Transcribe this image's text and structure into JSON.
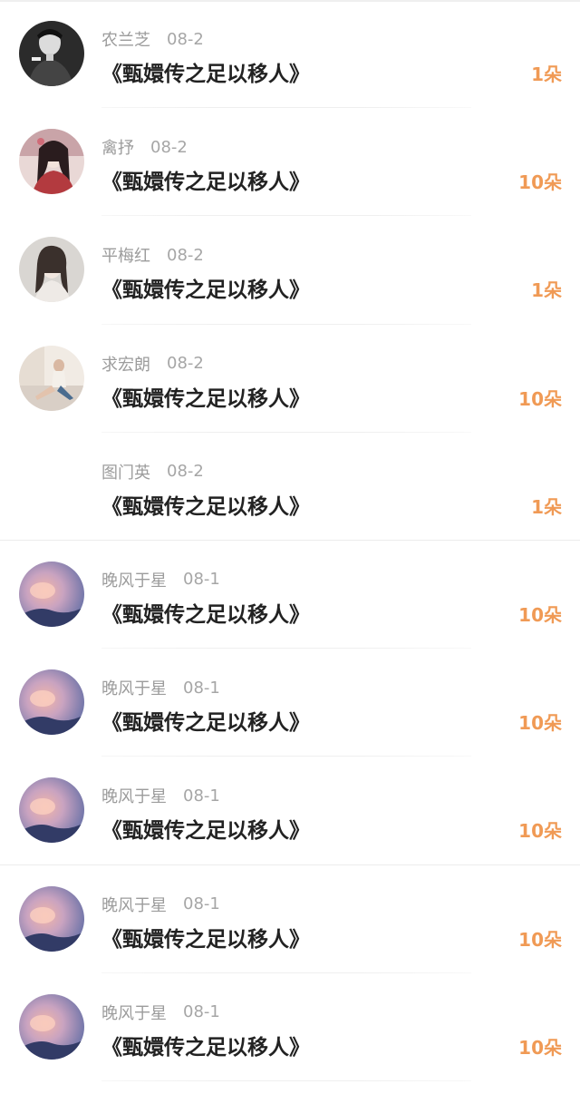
{
  "gifts": [
    {
      "user": "农兰芝",
      "date": "08-2",
      "title": "《甄嬛传之足以移人》",
      "count": "1朵",
      "avatar": "man-portrait"
    },
    {
      "user": "禽抒",
      "date": "08-2",
      "title": "《甄嬛传之足以移人》",
      "count": "10朵",
      "avatar": "costume-portrait"
    },
    {
      "user": "平梅红",
      "date": "08-2",
      "title": "《甄嬛传之足以移人》",
      "count": "1朵",
      "avatar": "woman-portrait"
    },
    {
      "user": "求宏朗",
      "date": "08-2",
      "title": "《甄嬛传之足以移人》",
      "count": "10朵",
      "avatar": "sitting-woman"
    },
    {
      "user": "图门英",
      "date": "08-2",
      "title": "《甄嬛传之足以移人》",
      "count": "1朵",
      "avatar": ""
    },
    {
      "user": "晚风于星",
      "date": "08-1",
      "title": "《甄嬛传之足以移人》",
      "count": "10朵",
      "avatar": "sunset-sky"
    },
    {
      "user": "晚风于星",
      "date": "08-1",
      "title": "《甄嬛传之足以移人》",
      "count": "10朵",
      "avatar": "sunset-sky"
    },
    {
      "user": "晚风于星",
      "date": "08-1",
      "title": "《甄嬛传之足以移人》",
      "count": "10朵",
      "avatar": "sunset-sky"
    },
    {
      "user": "晚风于星",
      "date": "08-1",
      "title": "《甄嬛传之足以移人》",
      "count": "10朵",
      "avatar": "sunset-sky"
    },
    {
      "user": "晚风于星",
      "date": "08-1",
      "title": "《甄嬛传之足以移人》",
      "count": "10朵",
      "avatar": "sunset-sky"
    }
  ],
  "colors": {
    "count_accent": "#f09a55",
    "title_text": "#222222",
    "meta_text": "#9c9c9c"
  }
}
